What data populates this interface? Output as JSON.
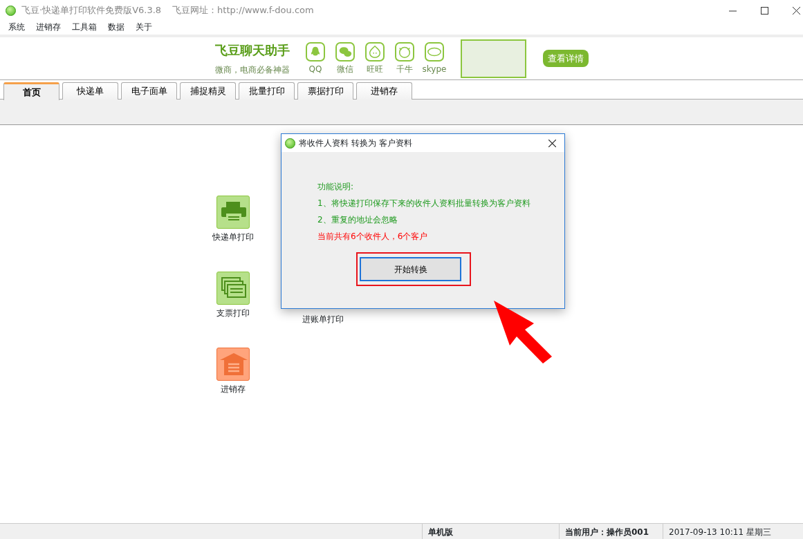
{
  "window": {
    "title": "飞豆·快递单打印软件免费版V6.3.8",
    "site": "飞豆网址：http://www.f-dou.com"
  },
  "menu": [
    "系统",
    "进销存",
    "工具箱",
    "数据",
    "关于"
  ],
  "banner": {
    "title": "飞豆聊天助手",
    "subtitle": "微商，电商必备神器",
    "apps": [
      {
        "kind": "qq",
        "label": "QQ"
      },
      {
        "kind": "wechat",
        "label": "微信"
      },
      {
        "kind": "wangwang",
        "label": "旺旺"
      },
      {
        "kind": "qianniu",
        "label": "千牛"
      },
      {
        "kind": "skype",
        "label": "skype"
      }
    ],
    "button": "查看详情"
  },
  "tabs": [
    {
      "label": "首页",
      "selected": true
    },
    {
      "label": "快递单",
      "selected": false
    },
    {
      "label": "电子面单",
      "selected": false
    },
    {
      "label": "捕捉精灵",
      "selected": false
    },
    {
      "label": "批量打印",
      "selected": false
    },
    {
      "label": "票据打印",
      "selected": false
    },
    {
      "label": "进销存",
      "selected": false
    }
  ],
  "home_items": [
    {
      "kind": "printer",
      "label": "快递单打印",
      "color": "#8cc63f"
    },
    {
      "kind": "none"
    },
    {
      "kind": "cheque",
      "label": "支票打印",
      "color": "#8cc63f"
    },
    {
      "kind": "text",
      "label": "进账单打印"
    },
    {
      "kind": "warehouse",
      "label": "进销存",
      "color": "#f07038"
    }
  ],
  "dialog": {
    "title": "将收件人资料 转换为 客户资料",
    "heading": "功能说明:",
    "lines": [
      "1、将快递打印保存下来的收件人资料批量转换为客户资料",
      "2、重复的地址会忽略"
    ],
    "notice": "当前共有6个收件人，6个客户",
    "button": "开始转换"
  },
  "status_bar": {
    "edition": "单机版",
    "user": "当前用户：操作员001",
    "datetime": "2017-09-13 10:11 星期三"
  }
}
